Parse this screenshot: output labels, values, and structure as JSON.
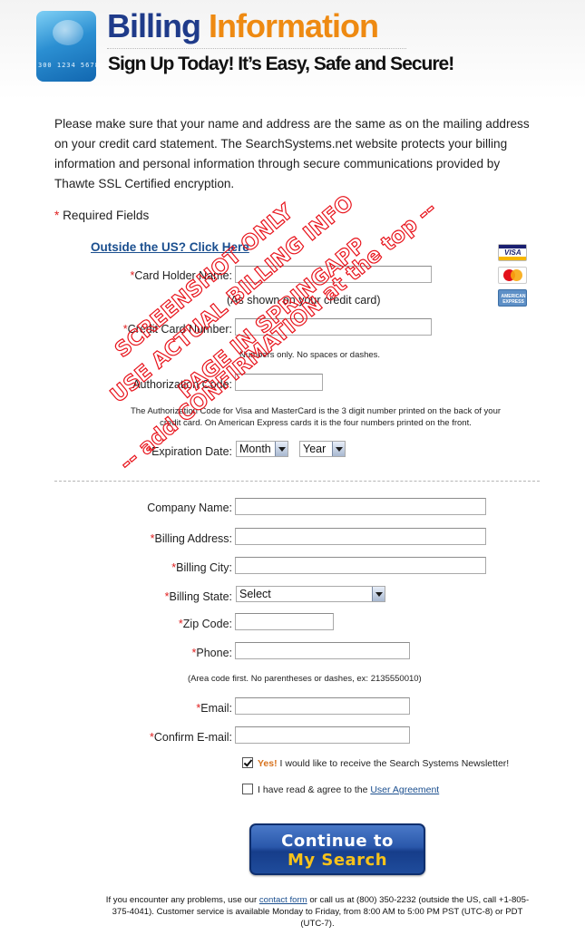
{
  "header": {
    "card_digits": "300 1234 5678",
    "title_part1": "Billing",
    "title_part2": "Information",
    "subtitle": "Sign Up Today!  It’s Easy, Safe and Secure!"
  },
  "intro": "Please make sure that your name and address are the same as on the mailing address on your credit card statement. The SearchSystems.net website protects your billing information and personal information through secure communications provided by Thawte SSL Certified encryption.",
  "required_note": "Required Fields",
  "outside_us_link": "Outside the US? Click Here",
  "card_logos": {
    "visa": "VISA",
    "mastercard": "MasterCard",
    "amex": "AMERICAN EXPRESS"
  },
  "card_section": {
    "holder_label": "Card Holder Name:",
    "holder_hint": "(As shown on your credit card)",
    "number_label": "Credit Card Number:",
    "number_hint": "Numbers only. No spaces or dashes.",
    "auth_label": "Authorization Code:",
    "auth_hint": "The Authorization Code for Visa and MasterCard is the 3 digit number printed on the back of your credit card. On American Express cards it is the four numbers printed on the front.",
    "exp_label": "Expiration Date:",
    "exp_month": "Month",
    "exp_year": "Year"
  },
  "billing_section": {
    "company_label": "Company Name:",
    "address_label": "Billing Address:",
    "city_label": "Billing City:",
    "state_label": "Billing State:",
    "state_value": "Select",
    "zip_label": "Zip Code:",
    "phone_label": "Phone:",
    "phone_hint": "(Area code first. No parentheses or dashes, ex: 2135550010)",
    "email_label": "Email:",
    "confirm_email_label": "Confirm E-mail:"
  },
  "checkboxes": {
    "newsletter_yes": "Yes!",
    "newsletter_text": "I would like to receive the Search Systems Newsletter!",
    "newsletter_checked": true,
    "agree_text": "I have read & agree to the",
    "agree_link": "User Agreement",
    "agree_checked": false
  },
  "continue_button": {
    "line1": "Continue to",
    "line2": "My Search"
  },
  "footer": {
    "part1": "If you encounter any problems, use our",
    "contact_link": "contact form",
    "part2": "or call us at (800) 350-2232 (outside the US, call +1-805-375-4041). Customer service is available Monday to Friday, from 8:00 AM to 5:00 PM PST (UTC-8) or PDT (UTC-7)."
  },
  "watermark": {
    "line1": "SCREENSHOT ONLY",
    "line2": "USE ACTUAL BILLING INFO",
    "line3": "PAGE IN SPRINGAPP",
    "line4": "-- add CONFIRMATION at the top --",
    "color": "#e8141c"
  }
}
